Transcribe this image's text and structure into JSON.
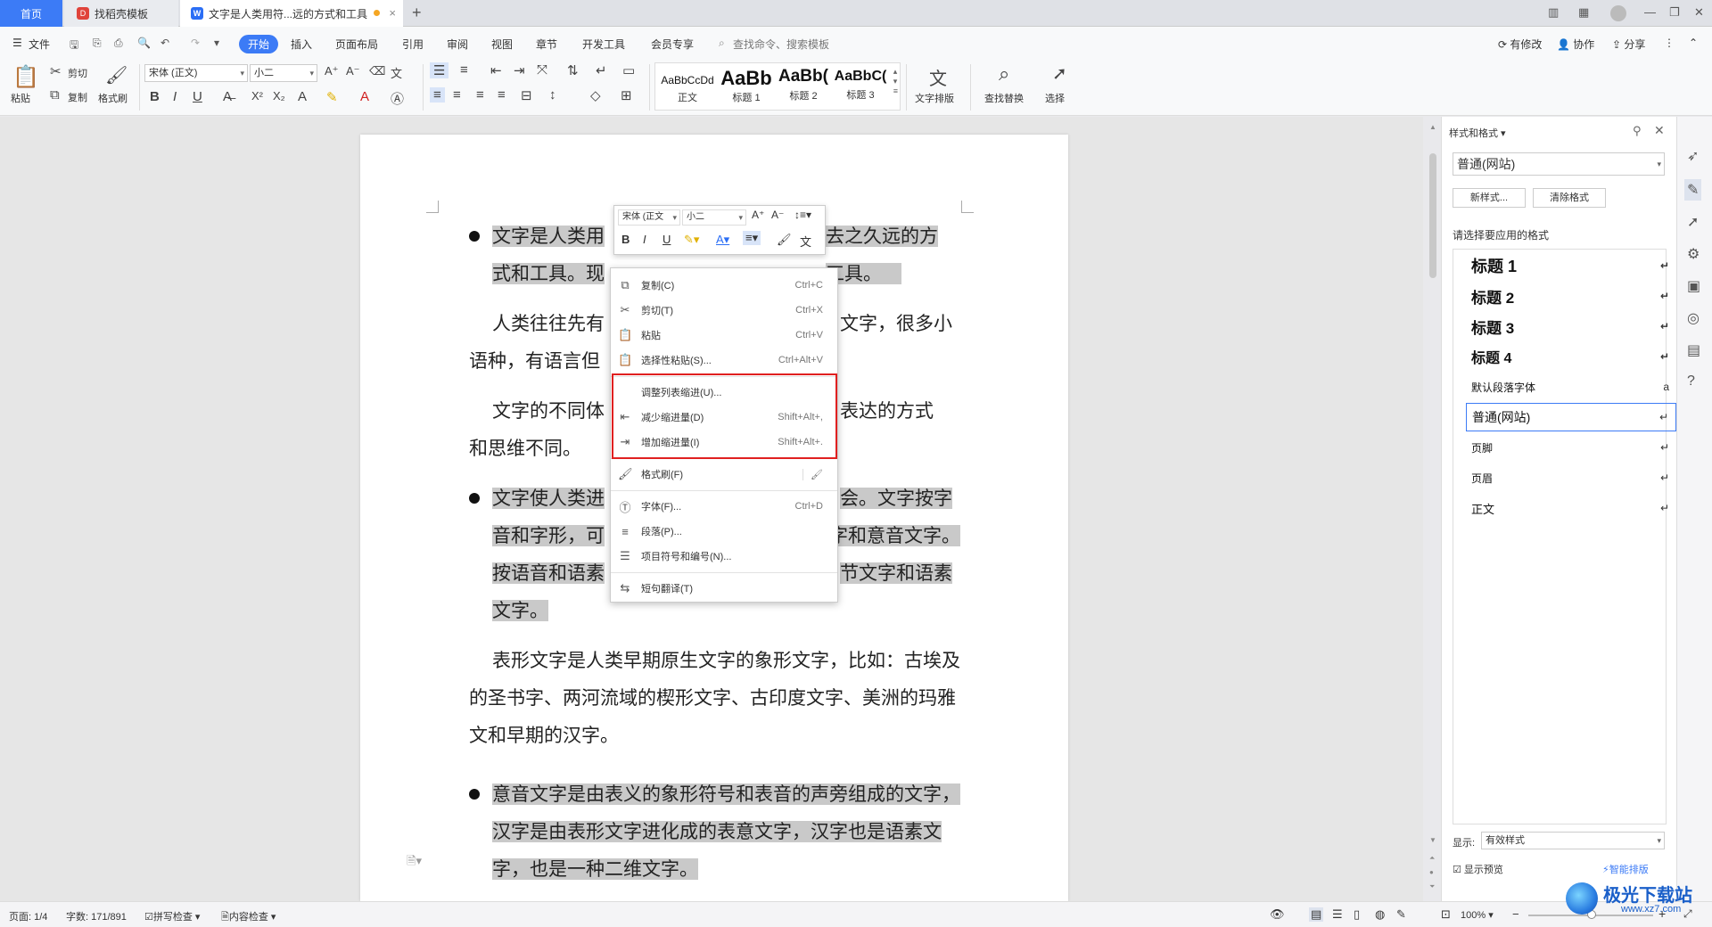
{
  "tabs": {
    "home": "首页",
    "templates": "找稻壳模板",
    "document": "文字是人类用符...远的方式和工具"
  },
  "menu": {
    "file": "文件",
    "items": [
      "开始",
      "插入",
      "页面布局",
      "引用",
      "审阅",
      "视图",
      "章节",
      "开发工具",
      "会员专享"
    ],
    "search": "查找命令、搜索模板",
    "right": [
      "有修改",
      "协作",
      "分享"
    ]
  },
  "ribbon": {
    "paste": "粘贴",
    "cut": "剪切",
    "copy": "复制",
    "format_painter": "格式刷",
    "font": "宋体 (正文)",
    "size": "小二",
    "styles": [
      {
        "preview": "AaBbCcDd",
        "name": "正文"
      },
      {
        "preview": "AaBb",
        "name": "标题 1"
      },
      {
        "preview": "AaBb(",
        "name": "标题 2"
      },
      {
        "preview": "AaBbC(",
        "name": "标题 3"
      }
    ],
    "text_layout": "文字排版",
    "find_replace": "查找替换",
    "select": "选择"
  },
  "document": {
    "p1a": "文字是人类用",
    "p1b": "去之久远的方",
    "p1c": "式和工具。现",
    "p1d": "工具。",
    "p2a": "人类往往先有",
    "p2b": "文字，很多小",
    "p2c": "语种，有语言但",
    "p3a": "文字的不同体",
    "p3b": "表达的方式",
    "p3c": "和思维不同。",
    "p4a": "文字使人类进",
    "p4b": "会。文字按字",
    "p4c": "音和字形，可",
    "p4d": "字和意音文字。",
    "p4e": "按语音和语素",
    "p4f": "节文字和语素",
    "p4g": "文字。",
    "p5": "表形文字是人类早期原生文字的象形文字，比如：古埃及的圣书字、两河流域的楔形文字、古印度文字、美洲的玛雅文和早期的汉字。",
    "p6": "意音文字是由表义的象形符号和表音的声旁组成的文字，汉字是由表形文字进化成的表意文字，汉字也是语素文字，也是一种二维文字。"
  },
  "floatbar": {
    "font": "宋体 (正文",
    "size": "小二"
  },
  "context_menu": {
    "copy": {
      "label": "复制(C)",
      "shortcut": "Ctrl+C"
    },
    "cut": {
      "label": "剪切(T)",
      "shortcut": "Ctrl+X"
    },
    "paste": {
      "label": "粘贴",
      "shortcut": "Ctrl+V"
    },
    "paste_special": {
      "label": "选择性粘贴(S)...",
      "shortcut": "Ctrl+Alt+V"
    },
    "adjust_indent": {
      "label": "调整列表缩进(U)..."
    },
    "decrease_indent": {
      "label": "减少缩进量(D)",
      "shortcut": "Shift+Alt+,"
    },
    "increase_indent": {
      "label": "增加缩进量(I)",
      "shortcut": "Shift+Alt+."
    },
    "format_painter": {
      "label": "格式刷(F)"
    },
    "font": {
      "label": "字体(F)...",
      "shortcut": "Ctrl+D"
    },
    "paragraph": {
      "label": "段落(P)..."
    },
    "bullets": {
      "label": "项目符号和编号(N)..."
    },
    "translate": {
      "label": "短句翻译(T)"
    }
  },
  "panel": {
    "title": "样式和格式",
    "current": "普通(网站)",
    "new_style": "新样式...",
    "clear_format": "清除格式",
    "choose_label": "请选择要应用的格式",
    "styles": [
      "标题 1",
      "标题 2",
      "标题 3",
      "标题 4",
      "默认段落字体",
      "普通(网站)",
      "页脚",
      "页眉",
      "正文"
    ],
    "show_label": "显示:",
    "show_value": "有效样式",
    "preview": "显示预览",
    "smart": "智能排版"
  },
  "status": {
    "page": "页面: 1/4",
    "words": "字数: 171/891",
    "spell": "拼写检查",
    "content": "内容检查",
    "zoom": "100%"
  },
  "watermark": "极光下载站",
  "watermark_url": "www.xz7.com"
}
